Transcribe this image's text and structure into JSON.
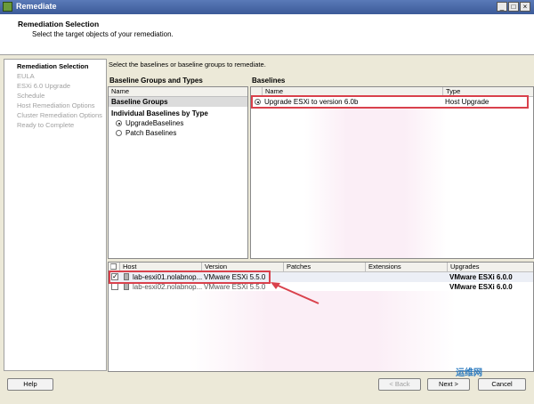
{
  "window": {
    "title": "Remediate"
  },
  "header": {
    "title": "Remediation Selection",
    "subtitle": "Select the target objects of your remediation."
  },
  "nav": {
    "items": [
      "Remediation Selection",
      "EULA",
      "ESXi 6.0 Upgrade",
      "Schedule",
      "Host Remediation Options",
      "Cluster Remediation Options",
      "Ready to Complete"
    ]
  },
  "main": {
    "instruction": "Select the baselines or baseline groups to remediate."
  },
  "groups_panel": {
    "title": "Baseline Groups and Types",
    "column": "Name",
    "baseline_groups": "Baseline Groups",
    "individual": "Individual Baselines by Type",
    "opt_upgrade": "UpgradeBaselines",
    "opt_patch": "Patch Baselines"
  },
  "baselines_panel": {
    "title": "Baselines",
    "col_name": "Name",
    "col_type": "Type",
    "row": {
      "name": "Upgrade ESXi to version 6.0b",
      "type": "Host Upgrade"
    }
  },
  "hosts_table": {
    "columns": [
      "Host",
      "Version",
      "Patches",
      "Extensions",
      "Upgrades"
    ],
    "rows": [
      {
        "host": "lab-esxi01.nolabnop...",
        "version": "VMware ESXi 5.5.0",
        "upgrades": "VMware ESXi 6.0.0",
        "checked": true
      },
      {
        "host": "lab-esxi02.nolabnop...",
        "version": "VMware ESXi 5.5.0",
        "upgrades": "VMware ESXi 6.0.0",
        "checked": false
      }
    ]
  },
  "buttons": {
    "help": "Help",
    "back": "< Back",
    "next": "Next >",
    "cancel": "Cancel"
  },
  "watermark": "运维网"
}
